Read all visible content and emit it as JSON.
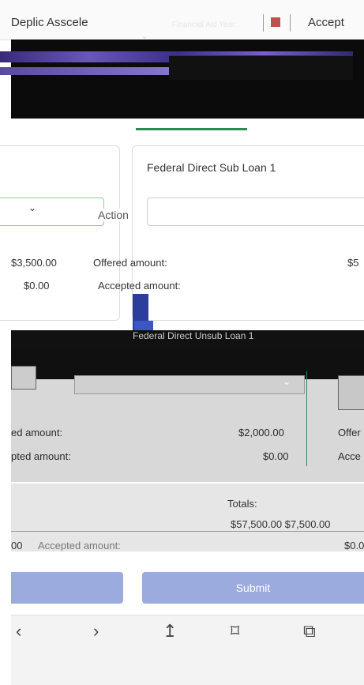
{
  "browser": {
    "left_title": "Deplic Asscele",
    "right_title": "Accept"
  },
  "header": {
    "financial_aid_label": "Financial Aid Year:"
  },
  "cards": {
    "right": {
      "title": "Federal Direct Sub Loan 1",
      "action_label": "Action",
      "offered_label": "Offered amount:",
      "offered_value": "$5",
      "accepted_label": "Accepted amount:"
    },
    "left": {
      "offered_value": "$3,500.00",
      "accepted_value": "$0.00"
    }
  },
  "middle": {
    "label": "Federal Direct Unsub Loan 1"
  },
  "gray_card": {
    "offered_label": "ed amount:",
    "offered_value": "$2,000.00",
    "offered_right": "Offer",
    "accepted_label": "pted amount:",
    "accepted_value": "$0.00",
    "accepted_right": "Acce"
  },
  "totals": {
    "label": "Totals:",
    "values": "$57,500.00 $7,500.00",
    "left_value": "00",
    "accepted_label": "Accepted amount:",
    "right_value": "$0.0"
  },
  "buttons": {
    "submit": "Submit"
  },
  "bottom_toolbar": {
    "icons": [
      "back-icon",
      "forward-icon",
      "share-icon",
      "bookmark-icon",
      "tabs-icon"
    ]
  }
}
